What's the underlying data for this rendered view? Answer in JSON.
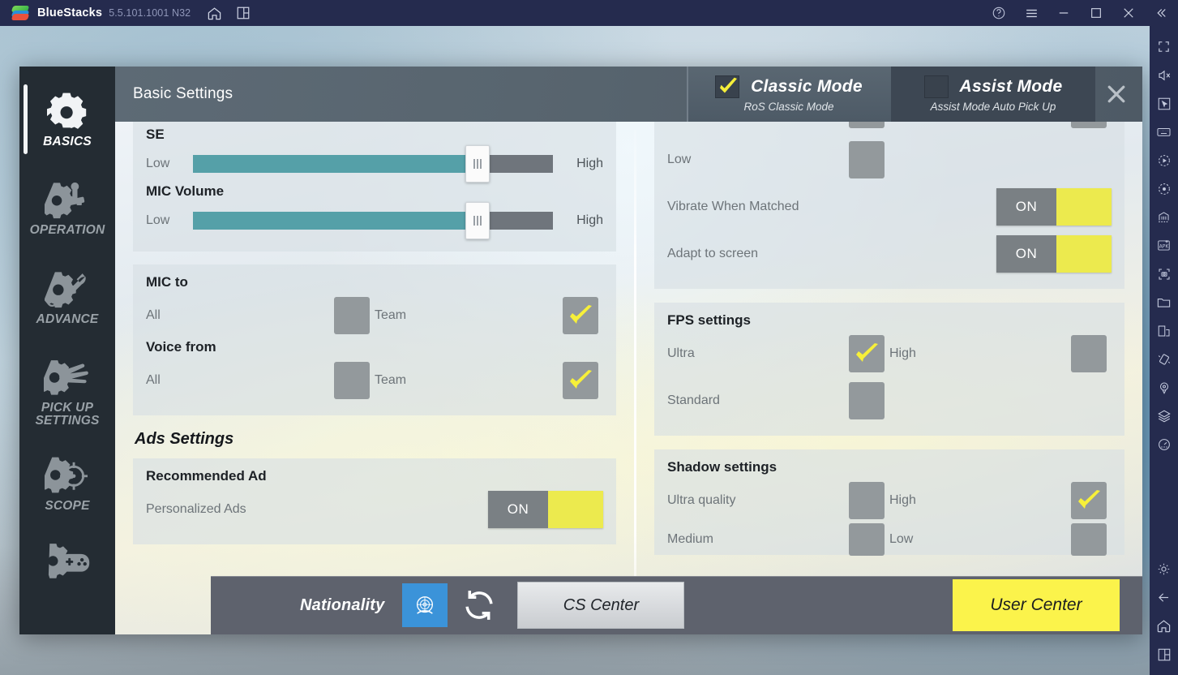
{
  "titlebar": {
    "app_name": "BlueStacks",
    "version": "5.5.101.1001 N32",
    "icons": [
      "home-icon",
      "multi-instance-icon"
    ],
    "right_icons": [
      "help-icon",
      "menu-icon",
      "minimize-icon",
      "maximize-icon",
      "close-icon",
      "collapse-icon"
    ]
  },
  "sidebar": {
    "items": [
      {
        "label": "BASICS",
        "icon": "gear-icon",
        "active": true
      },
      {
        "label": "OPERATION",
        "icon": "gear-joystick-icon",
        "active": false
      },
      {
        "label": "ADVANCE",
        "icon": "gear-wrench-icon",
        "active": false
      },
      {
        "label": "PICK UP\nSETTINGS",
        "icon": "gear-hand-icon",
        "active": false
      },
      {
        "label": "SCOPE",
        "icon": "gear-scope-icon",
        "active": false
      },
      {
        "label": "",
        "icon": "gear-gamepad-icon",
        "active": false
      }
    ]
  },
  "header": {
    "title": "Basic Settings",
    "close_icon": "close-icon",
    "tabs": [
      {
        "name": "Classic Mode",
        "sub": "RoS Classic Mode",
        "checked": true
      },
      {
        "name": "Assist Mode",
        "sub": "Assist Mode Auto Pick Up",
        "checked": false
      }
    ]
  },
  "left_column": {
    "audio_card": {
      "se_label": "SE",
      "se_slider": {
        "low": "Low",
        "high": "High",
        "value": 83
      },
      "mic_label": "MIC Volume",
      "mic_slider": {
        "low": "Low",
        "high": "High",
        "value": 83
      }
    },
    "mic_card": {
      "mic_to_title": "MIC to",
      "mic_to_options": [
        {
          "label": "All",
          "checked": false
        },
        {
          "label": "Team",
          "checked": true
        }
      ],
      "voice_from_title": "Voice from",
      "voice_from_options": [
        {
          "label": "All",
          "checked": false
        },
        {
          "label": "Team",
          "checked": true
        }
      ]
    },
    "ads_section_title": "Ads Settings",
    "ads_card": {
      "title": "Recommended Ad",
      "row_label": "Personalized Ads",
      "toggle_state": "ON"
    }
  },
  "right_column": {
    "top_card": {
      "low_label": "Low",
      "rows": [
        {
          "label": "Vibrate When Matched",
          "toggle_state": "ON"
        },
        {
          "label": "Adapt to screen",
          "toggle_state": "ON"
        }
      ]
    },
    "fps_card": {
      "title": "FPS settings",
      "options": [
        {
          "label": "Ultra",
          "checked": true
        },
        {
          "label": "High",
          "checked": false
        },
        {
          "label": "Standard",
          "checked": false
        }
      ]
    },
    "shadow_card": {
      "title": "Shadow settings",
      "options": [
        {
          "label": "Ultra quality",
          "checked": false
        },
        {
          "label": "High",
          "checked": true
        },
        {
          "label": "Medium",
          "checked": false
        },
        {
          "label": "Low",
          "checked": false
        }
      ]
    }
  },
  "footer": {
    "nationality_label": "Nationality",
    "flag_icon": "un-flag-icon",
    "refresh_icon": "refresh-icon",
    "cs_center_label": "CS Center",
    "user_center_label": "User Center"
  },
  "colors": {
    "accent_yellow": "#ecea4e",
    "user_center_yellow": "#fbf34b",
    "slider_teal": "#55a0a8",
    "titlebar_navy": "#252b4e",
    "sidebar_dark": "#242c33",
    "footer_gray": "#5e626d",
    "flag_blue": "#3b93d9"
  },
  "rail_icons": [
    "fullscreen-icon",
    "mute-icon",
    "cursor-icon",
    "keyboard-icon",
    "macro-play-icon",
    "record-icon",
    "eco-mode-icon",
    "install-apk-icon",
    "screenshot-icon",
    "media-folder-icon",
    "multi-window-icon",
    "shake-icon",
    "location-icon",
    "layers-icon",
    "meter-icon",
    "gear-icon",
    "back-icon",
    "home-icon",
    "recents-icon"
  ]
}
